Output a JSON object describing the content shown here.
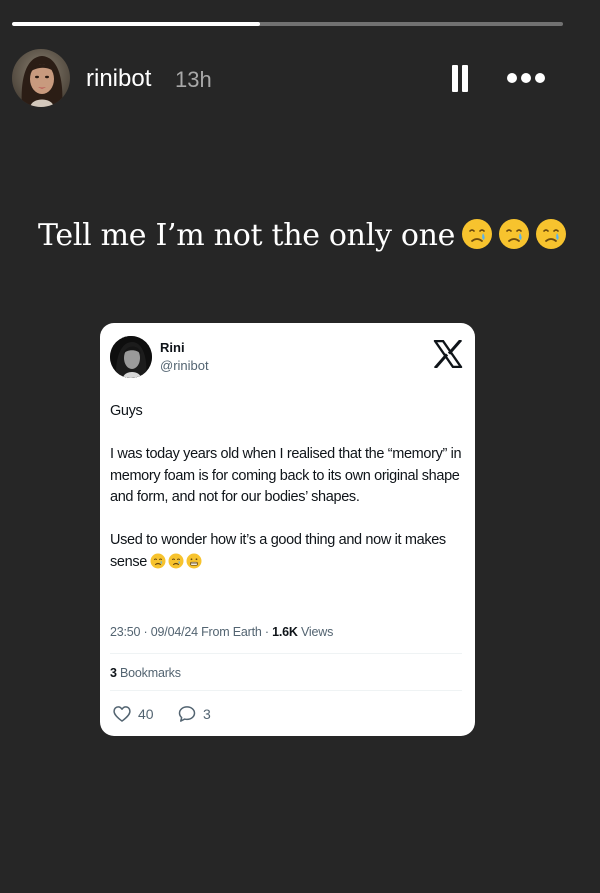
{
  "story": {
    "progress": 0.45,
    "username": "rinibot",
    "time_ago": "13h",
    "caption": "Tell me I’m not the only one",
    "caption_emojis": [
      "crying-face-emoji",
      "crying-face-emoji",
      "crying-face-emoji"
    ]
  },
  "controls": {
    "pause_icon": "pause-icon",
    "more_icon": "more-options-icon"
  },
  "tweet": {
    "name": "Rini",
    "handle": "@rinibot",
    "platform_icon": "x-logo-icon",
    "paragraphs": [
      "Guys",
      "I was today years old when I realised that the “memory” in memory foam is for coming back to its own original shape and form, and not for our bodies’ shapes.",
      "Used to wonder how it’s a good thing and now it makes sense"
    ],
    "text_emojis": [
      "crying-face-emoji",
      "crying-face-emoji",
      "grimacing-face-emoji"
    ],
    "timestamp": "23:50 · 09/04/24 From Earth · ",
    "views_count": "1.6K",
    "views_label": " Views",
    "bookmarks_count": "3",
    "bookmarks_label": " Bookmarks",
    "likes": "40",
    "replies": "3"
  },
  "colors": {
    "background": "#262626",
    "card": "#ffffff",
    "muted_text": "#536471",
    "emoji_yellow": "#f7c32e",
    "tear_blue": "#5ab3f0"
  }
}
